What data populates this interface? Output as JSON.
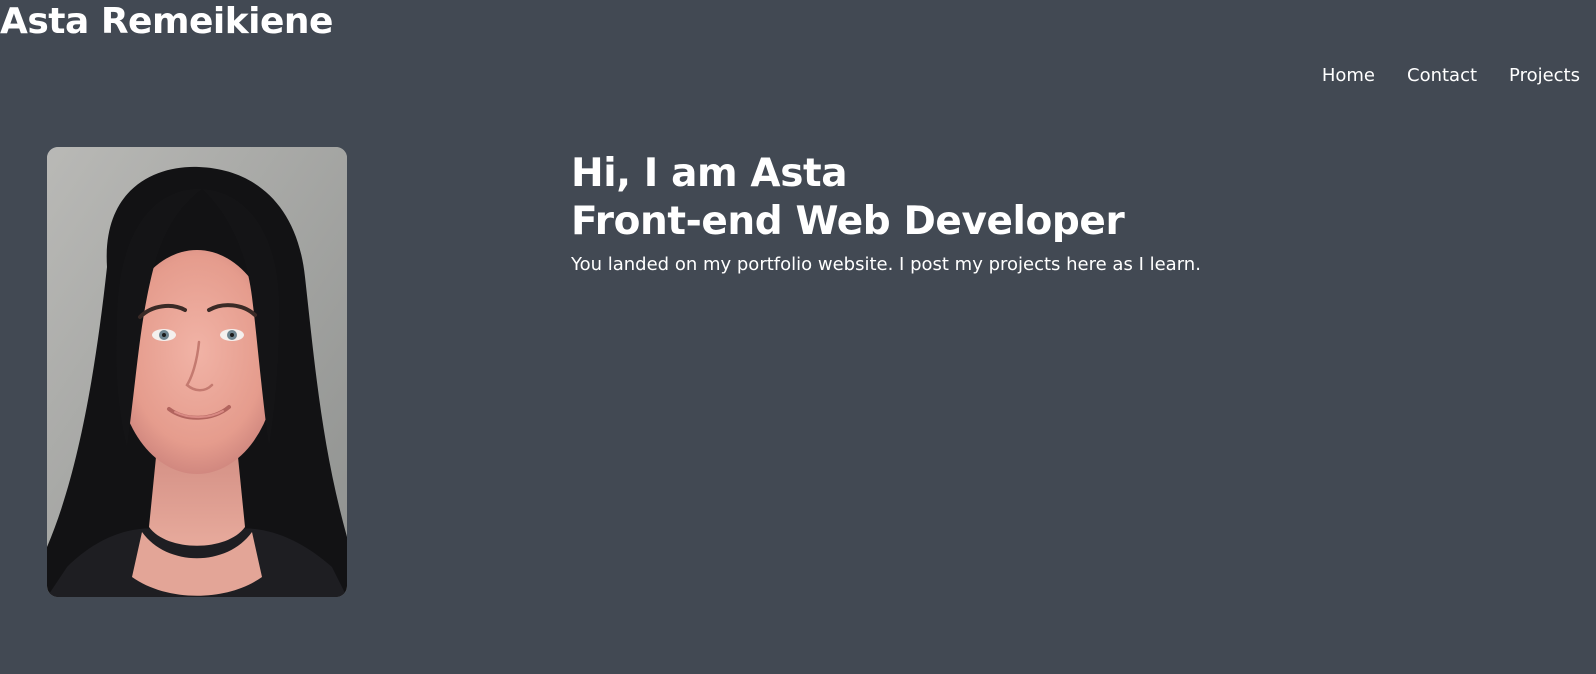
{
  "site": {
    "title": "Asta Remeikiene"
  },
  "nav": {
    "items": [
      {
        "label": "Home"
      },
      {
        "label": "Contact"
      },
      {
        "label": "Projects"
      }
    ]
  },
  "hero": {
    "greeting": "Hi, I am Asta",
    "role": "Front-end Web Developer",
    "tagline": "You landed on my portfolio website. I post my projects here as I learn."
  },
  "colors": {
    "background": "#424953",
    "text": "#ffffff"
  },
  "icons": {
    "portrait": "profile-photo"
  }
}
